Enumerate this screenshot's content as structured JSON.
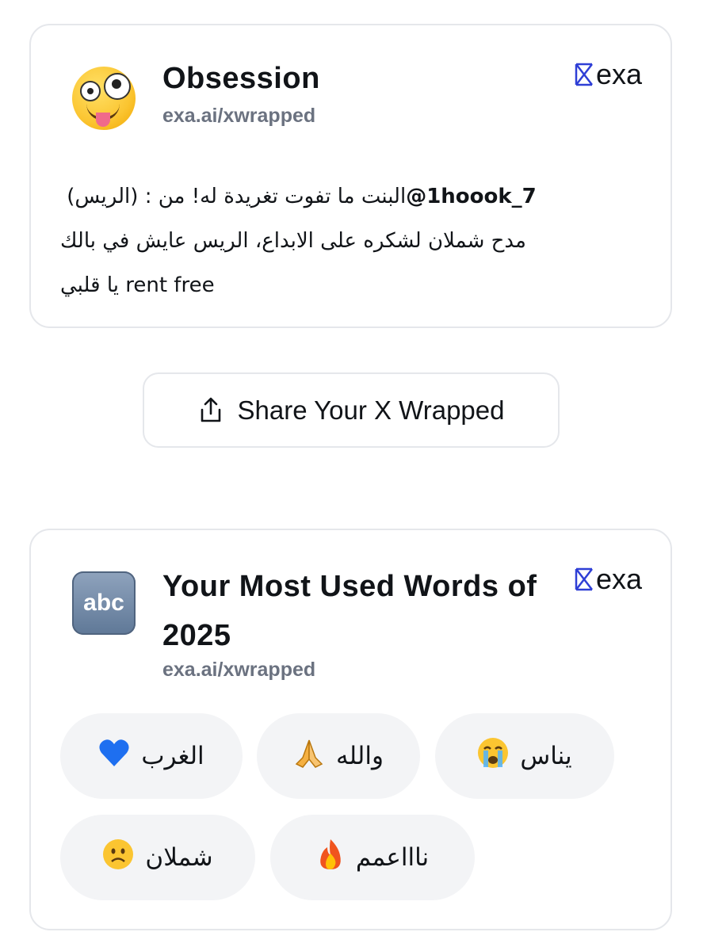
{
  "cards": {
    "obsession": {
      "title": "Obsession",
      "subtitle": "exa.ai/xwrapped",
      "brand": "exa",
      "icon": "zany-face-emoji",
      "tweet": {
        "line1_rtl": "البنت ما تفوت تغريدة له! من : (الريس) ",
        "mention": "@1hoook_7",
        "line2": "مدح شملان لشكره على الابداع، الريس عايش في بالك",
        "line3_rtl": "يا قلبي",
        "line3_ltr": "rent free"
      }
    },
    "words": {
      "title": "Your Most Used Words of 2025",
      "subtitle": "exa.ai/xwrapped",
      "brand": "exa",
      "icon_text": "abc",
      "words": [
        {
          "word": "يناس",
          "emoji": "😭",
          "emoji_name": "loudly-crying-face"
        },
        {
          "word": "والله",
          "emoji": "🙏",
          "emoji_name": "folded-hands"
        },
        {
          "word": "الغرب",
          "emoji": "💙",
          "emoji_name": "blue-heart"
        },
        {
          "word": "ناااعمم",
          "emoji": "🔥",
          "emoji_name": "fire"
        },
        {
          "word": "شملان",
          "emoji": "☹",
          "emoji_name": "frowning-face"
        }
      ]
    }
  },
  "share": {
    "label": "Share Your X Wrapped",
    "icon": "share-upload-icon"
  },
  "colors": {
    "border": "#e5e7eb",
    "pill_bg": "#f3f4f6",
    "subtitle": "#6b7280",
    "brand_mark": "#2f3fd6"
  }
}
